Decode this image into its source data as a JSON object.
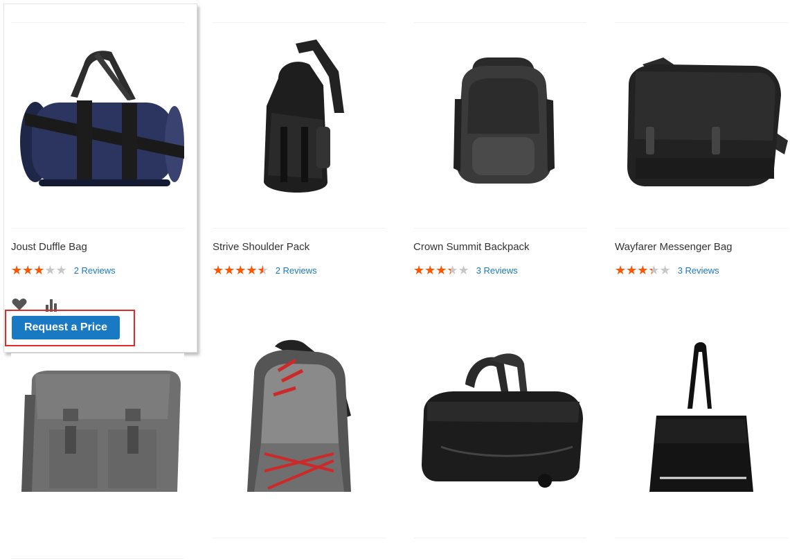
{
  "products": [
    {
      "name": "Joust Duffle Bag",
      "rating_percent": 60,
      "reviews": "2  Reviews",
      "image": "duffle-bag-navy"
    },
    {
      "name": "Strive Shoulder Pack",
      "rating_percent": 90,
      "reviews": "2  Reviews",
      "image": "sling-backpack-black"
    },
    {
      "name": "Crown Summit Backpack",
      "rating_percent": 67,
      "reviews": "3  Reviews",
      "image": "backpack-gray"
    },
    {
      "name": "Wayfarer Messenger Bag",
      "rating_percent": 67,
      "reviews": "3  Reviews",
      "image": "messenger-bag-black"
    },
    {
      "image": "messenger-bag-gray-canvas"
    },
    {
      "image": "backpack-gray-red-cords"
    },
    {
      "image": "rolling-duffle-black"
    },
    {
      "image": "tote-bag-black"
    }
  ],
  "hover_actions": {
    "wishlist_icon": "heart-icon",
    "compare_icon": "bar-chart-icon"
  },
  "request_price_label": "Request a Price",
  "stars_glyphs": "★★★★★",
  "colors": {
    "star_filled": "#ff5501",
    "star_empty": "#c7c7c7",
    "link": "#1979c3",
    "button": "#1979c3",
    "highlight": "#e02b27"
  }
}
